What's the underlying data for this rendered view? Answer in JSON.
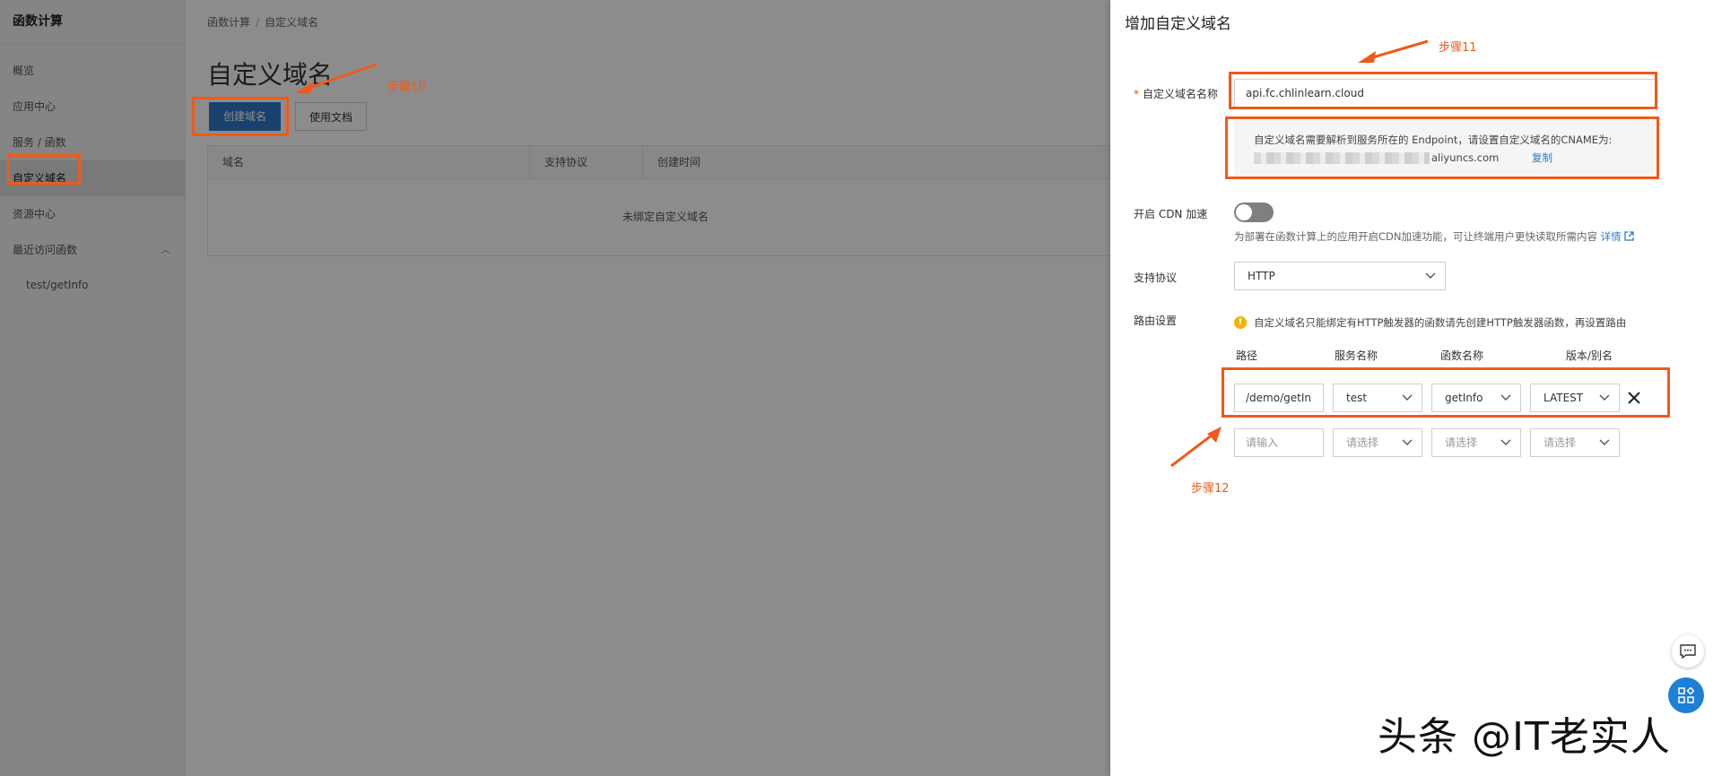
{
  "sidebar": {
    "title": "函数计算",
    "items": [
      {
        "label": "概览"
      },
      {
        "label": "应用中心"
      },
      {
        "label": "服务 / 函数"
      },
      {
        "label": "自定义域名"
      },
      {
        "label": "资源中心"
      },
      {
        "label": "最近访问函数"
      },
      {
        "label": "test/getInfo"
      }
    ],
    "collapse_handle": "‹"
  },
  "breadcrumb": {
    "root": "函数计算",
    "sep": "/",
    "current": "自定义域名"
  },
  "page": {
    "title": "自定义域名",
    "create_button": "创建域名",
    "docs_button": "使用文档",
    "table": {
      "columns": [
        "域名",
        "支持协议",
        "创建时间"
      ],
      "empty_text": "未绑定自定义域名"
    }
  },
  "drawer": {
    "title": "增加自定义域名",
    "domain_label": "自定义域名名称",
    "domain_value": "api.fc.chlinlearn.cloud",
    "cname_line1": "自定义域名需要解析到服务所在的 Endpoint，请设置自定义域名的CNAME为:",
    "cname_suffix": "aliyuncs.com",
    "copy_label": "复制",
    "cdn_label": "开启 CDN 加速",
    "cdn_enabled": false,
    "cdn_desc": "为部署在函数计算上的应用开启CDN加速功能，可让终端用户更快读取所需内容",
    "cdn_detail": "详情",
    "protocol_label": "支持协议",
    "protocol_value": "HTTP",
    "route_label": "路由设置",
    "route_warning": "自定义域名只能绑定有HTTP触发器的函数请先创建HTTP触发器函数，再设置路由",
    "route_columns": [
      "路径",
      "服务名称",
      "函数名称",
      "版本/别名"
    ],
    "route_row": {
      "path": "/demo/getIn",
      "service": "test",
      "function": "getInfo",
      "version": "LATEST"
    },
    "route_new": {
      "path_placeholder": "请输入",
      "service_placeholder": "请选择",
      "function_placeholder": "请选择",
      "version_placeholder": "请选择"
    }
  },
  "annotations": {
    "step10": "步骤10",
    "step11": "步骤11",
    "step12": "步骤12",
    "color": "#ef5a1a"
  },
  "watermark": "头条 @IT老实人"
}
